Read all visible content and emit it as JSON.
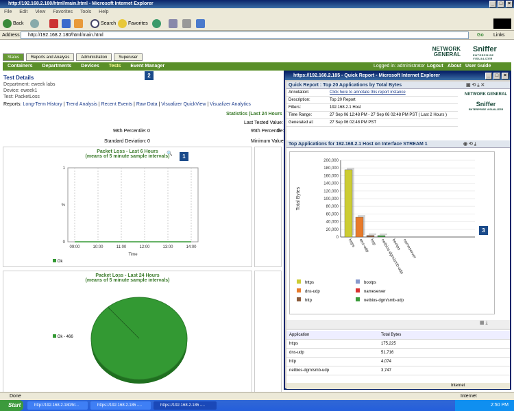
{
  "window": {
    "title": "http://192.168.2.180/html/main.html - Microsoft Internet Explorer"
  },
  "menu": [
    "File",
    "Edit",
    "View",
    "Favorites",
    "Tools",
    "Help"
  ],
  "toolbar": {
    "back": "Back",
    "search": "Search",
    "favorites": "Favorites"
  },
  "address": {
    "label": "Address",
    "url": "http://192.168.2.180/html/main.html",
    "go": "Go",
    "links": "Links"
  },
  "app": {
    "tabs": [
      "Status",
      "Reports and Analysis",
      "Administration",
      "Superuser"
    ],
    "subnav": [
      "Containers",
      "Departments",
      "Devices",
      "Tests",
      "Event Manager"
    ],
    "logged_in": "Logged in: administrator",
    "top_links": [
      "Logout",
      "About",
      "User Guide"
    ],
    "brand": "NETWORK GENERAL",
    "brand2": "Sniffer",
    "brand2_sub": "ENTERPRISE VISUALIZER"
  },
  "test": {
    "heading": "Test Details",
    "department": "Department: eweek labs",
    "device": "Device: eweek1",
    "test": "Test: PacketLoss",
    "reports_label": "Reports:",
    "report_links": [
      "Long-Term History",
      "Trend Analysis",
      "Recent Events",
      "Raw Data",
      "Visualizer QuickView",
      "Visualizer Analytics"
    ],
    "stats_title": "Statistics (Last 24 Hours",
    "last_tested": "Last Tested Value:",
    "p98_label": "98th Percentile:",
    "p98_value": "0",
    "p95_label": "95th Percentile:",
    "p95_value": "0",
    "sd_label": "Standard Deviation:",
    "sd_value": "0",
    "min_label": "Minimum Value:"
  },
  "chart_data": [
    {
      "type": "line",
      "title": "Packet Loss - Last 6 Hours",
      "subtitle": "(means of 5 minute sample intervals)",
      "xlabel": "Time",
      "ylabel": "%",
      "x_ticks": [
        "09:00",
        "10:00",
        "11:00",
        "12:00",
        "13:00",
        "14:00"
      ],
      "y_ticks": [
        "1",
        "",
        "",
        "",
        "%",
        "",
        "",
        "",
        "0"
      ],
      "series": [
        {
          "name": "Ok",
          "color": "#339933",
          "values": [
            0,
            0,
            0,
            0,
            0,
            0
          ]
        }
      ],
      "ylim": [
        0,
        1
      ]
    },
    {
      "type": "pie",
      "title": "Packet Loss - Last 24 Hours",
      "subtitle": "(means of 5 minute sample intervals)",
      "slices": [
        {
          "label": "Ok - 466",
          "value": 466,
          "color": "#339933"
        }
      ]
    },
    {
      "type": "bar",
      "title": "Top Applications for 192.168.2.1 Host on Interface STREAM 1",
      "ylabel": "Total Bytes",
      "categories": [
        "https",
        "dns-udp",
        "http",
        "netbios-dgm/smb-udp",
        "bootps",
        "nameserver"
      ],
      "values": [
        175225,
        51716,
        4074,
        3747,
        0,
        0
      ],
      "colors": [
        "#cccc33",
        "#e87a2a",
        "#8a5a3a",
        "#3a9a3a",
        "#8899cc",
        "#d83030"
      ],
      "y_ticks": [
        "200,000",
        "180,000",
        "160,000",
        "140,000",
        "120,000",
        "100,000",
        "80,000",
        "60,000",
        "40,000",
        "20,000",
        "0"
      ],
      "ylim": [
        0,
        200000
      ]
    }
  ],
  "popup": {
    "title": "https://192.168.2.185 - Quick Report - Microsoft Internet Explorer",
    "header": "Quick Report : Top 20 Applications by Total Bytes",
    "rows": [
      {
        "k": "Annotation:",
        "v": "Click here to annotate this report instance"
      },
      {
        "k": "Description:",
        "v": "Top 20 Report"
      },
      {
        "k": "Filters:",
        "v": "192.168.2.1 Host"
      },
      {
        "k": "Time Range:",
        "v": "27 Sep 06 12:48 PM - 27 Sep 06 02:48 PM PST ( Last 2 Hours )"
      },
      {
        "k": "Generated at:",
        "v": "27 Sep 06 02:48 PM PST"
      }
    ],
    "chart_header": "Top Applications for 192.168.2.1 Host on Interface STREAM 1",
    "legend": [
      "https",
      "bootps",
      "dns-udp",
      "nameserver",
      "http",
      "netbios-dgm/smb-udp"
    ],
    "table_headers": [
      "Application",
      "Total Bytes"
    ],
    "table_rows": [
      [
        "https",
        "175,225"
      ],
      [
        "dns-udp",
        "51,716"
      ],
      [
        "http",
        "4,074"
      ],
      [
        "netbios-dgm/smb-udp",
        "3,747"
      ]
    ],
    "zone": "Internet"
  },
  "callouts": [
    "1",
    "2",
    "3"
  ],
  "status": {
    "text": "Done",
    "zone": "Internet"
  },
  "taskbar": {
    "start": "Start",
    "tasks": [
      "http://192.168.2.180/ht...",
      "https://192.168.2.185 -...",
      "https://192.168.2.185 -..."
    ],
    "time": "2:50 PM"
  }
}
